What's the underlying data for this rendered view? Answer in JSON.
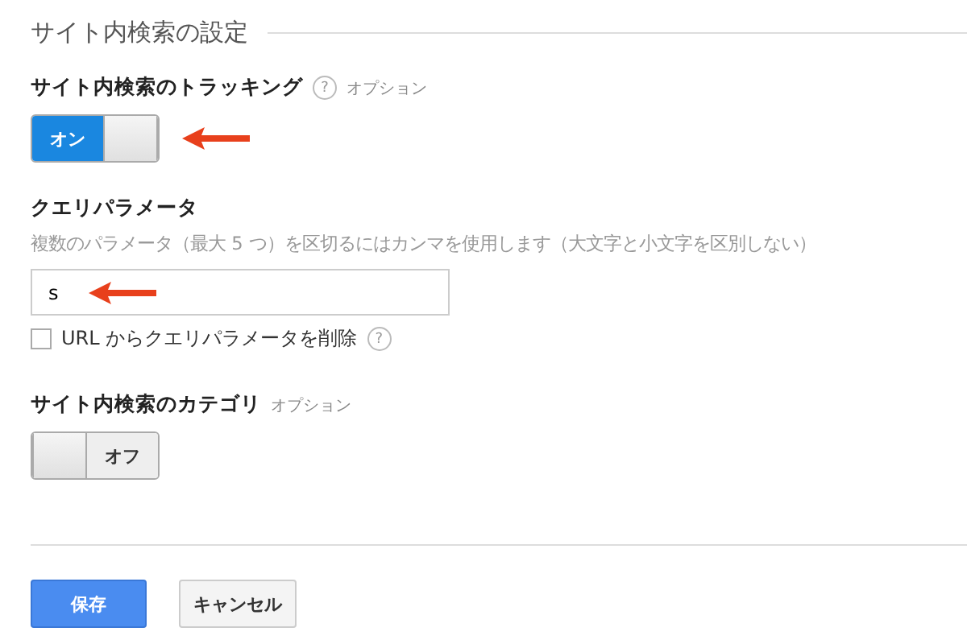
{
  "section_title": "サイト内検索の設定",
  "tracking": {
    "label": "サイト内検索のトラッキング",
    "help": "?",
    "optional": "オプション",
    "toggle": {
      "label": "オン",
      "on": true
    },
    "arrow": true
  },
  "query": {
    "label": "クエリパラメータ",
    "hint": "複数のパラメータ（最大 5 つ）を区切るにはカンマを使用します（大文字と小文字を区別しない）",
    "value": "s",
    "arrow": true,
    "remove_checkbox": {
      "label": "URL からクエリパラメータを削除",
      "help": "?",
      "checked": false
    }
  },
  "category": {
    "label": "サイト内検索のカテゴリ",
    "optional": "オプション",
    "toggle": {
      "label": "オフ",
      "on": false
    }
  },
  "buttons": [
    {
      "label": "保存",
      "kind": "primary"
    },
    {
      "label": "キャンセル",
      "kind": "secondary"
    }
  ]
}
